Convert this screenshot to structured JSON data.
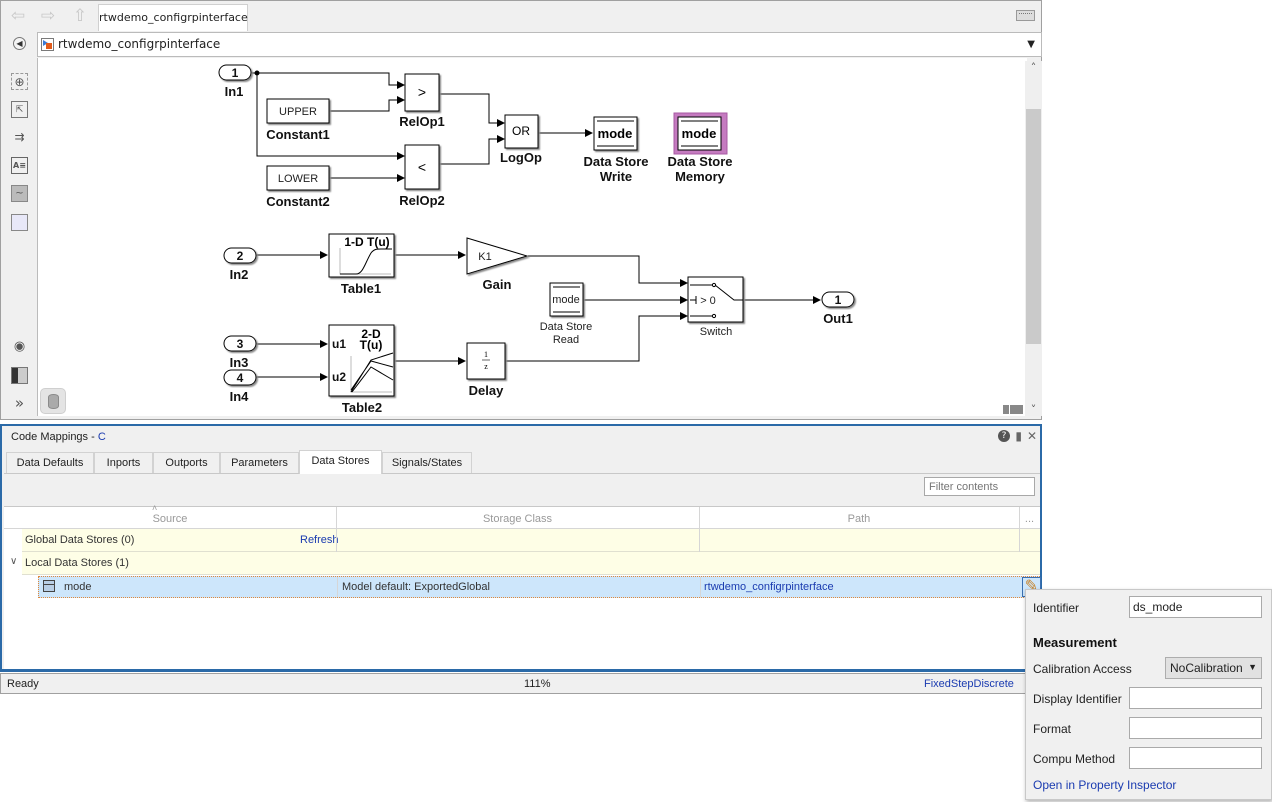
{
  "window": {
    "tab_title": "rtwdemo_configrpinterface",
    "address": "rtwdemo_configrpinterface"
  },
  "toolbar": {
    "nav": [
      "back-icon",
      "forward-icon",
      "up-icon"
    ],
    "palette": [
      "zoom-icon",
      "fit-view-icon",
      "signal-routing-icon",
      "annotation-icon",
      "image-icon",
      "area-icon",
      "camera-icon",
      "model-browser-icon",
      "expand-icon"
    ]
  },
  "diagram": {
    "in1": {
      "port": "1",
      "name": "In1"
    },
    "constant1": {
      "value": "UPPER",
      "name": "Constant1"
    },
    "constant2": {
      "value": "LOWER",
      "name": "Constant2"
    },
    "relop1": {
      "op": ">",
      "name": "RelOp1"
    },
    "relop2": {
      "op": "<",
      "name": "RelOp2"
    },
    "logop": {
      "op": "OR",
      "name": "LogOp"
    },
    "dsw": {
      "var": "mode",
      "name_l1": "Data Store",
      "name_l2": "Write"
    },
    "dsm": {
      "var": "mode",
      "name_l1": "Data Store",
      "name_l2": "Memory"
    },
    "in2": {
      "port": "2",
      "name": "In2"
    },
    "table1": {
      "title": "1-D T(u)",
      "name": "Table1"
    },
    "gain": {
      "value": "K1",
      "name": "Gain"
    },
    "dsr": {
      "var": "mode",
      "name_l1": "Data Store",
      "name_l2": "Read"
    },
    "switch": {
      "cond": "> 0",
      "name": "Switch"
    },
    "out1": {
      "port": "1",
      "name": "Out1"
    },
    "in3": {
      "port": "3",
      "name": "In3"
    },
    "in4": {
      "port": "4",
      "name": "In4"
    },
    "table2": {
      "title_l1": "2-D",
      "title_l2": "T(u)",
      "u1": "u1",
      "u2": "u2",
      "name": "Table2"
    },
    "delay": {
      "num": "1",
      "den": "z",
      "name": "Delay"
    }
  },
  "code_mappings": {
    "title_prefix": "Code Mappings - ",
    "title_lang": "C",
    "tabs": [
      "Data Defaults",
      "Inports",
      "Outports",
      "Parameters",
      "Data Stores",
      "Signals/States"
    ],
    "active_tab": "Data Stores",
    "filter_placeholder": "Filter contents",
    "columns": [
      "Source",
      "Storage Class",
      "Path",
      "..."
    ],
    "groups": [
      {
        "label": "Global Data Stores (0)",
        "action": "Refresh"
      },
      {
        "label": "Local Data Stores (1)"
      }
    ],
    "rows": [
      {
        "source": "mode",
        "storage_class": "Model default: ExportedGlobal",
        "path": "rtwdemo_configrpinterface"
      }
    ]
  },
  "status": {
    "left": "Ready",
    "zoom": "111%",
    "solver": "FixedStepDiscrete"
  },
  "popup": {
    "identifier_label": "Identifier",
    "identifier_value": "ds_mode",
    "section": "Measurement",
    "calib_label": "Calibration Access",
    "calib_value": "NoCalibration",
    "display_id_label": "Display Identifier",
    "display_id_value": "",
    "format_label": "Format",
    "format_value": "",
    "compu_label": "Compu Method",
    "compu_value": "",
    "link": "Open in Property Inspector"
  }
}
